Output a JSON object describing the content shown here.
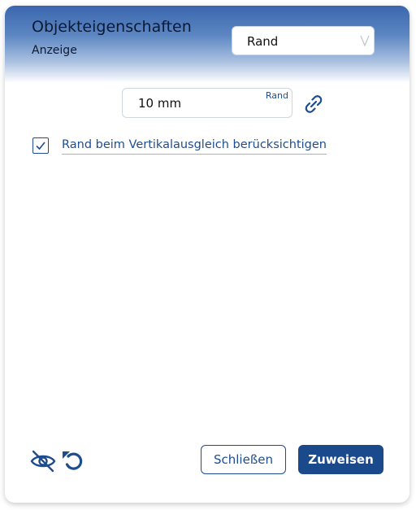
{
  "dialog": {
    "title": "Objekteigenschaften",
    "subtitle": "Anzeige",
    "category_select": {
      "value": "Rand"
    },
    "margin_field": {
      "value": "10 mm",
      "label": "Rand"
    },
    "checkbox": {
      "checked": true,
      "label": "Rand beim Vertikalausgleich berücksichtigen"
    },
    "footer": {
      "close_label": "Schließen",
      "assign_label": "Zuweisen"
    }
  },
  "icons": {
    "link": "link-icon",
    "visibility": "eye-off-icon",
    "reset": "undo-icon",
    "chevron": "chevron-down-icon",
    "check": "check-icon"
  },
  "colors": {
    "accent": "#1e4d8f",
    "header_top": "#3a67ae",
    "button_primary": "#1b4a8c"
  }
}
